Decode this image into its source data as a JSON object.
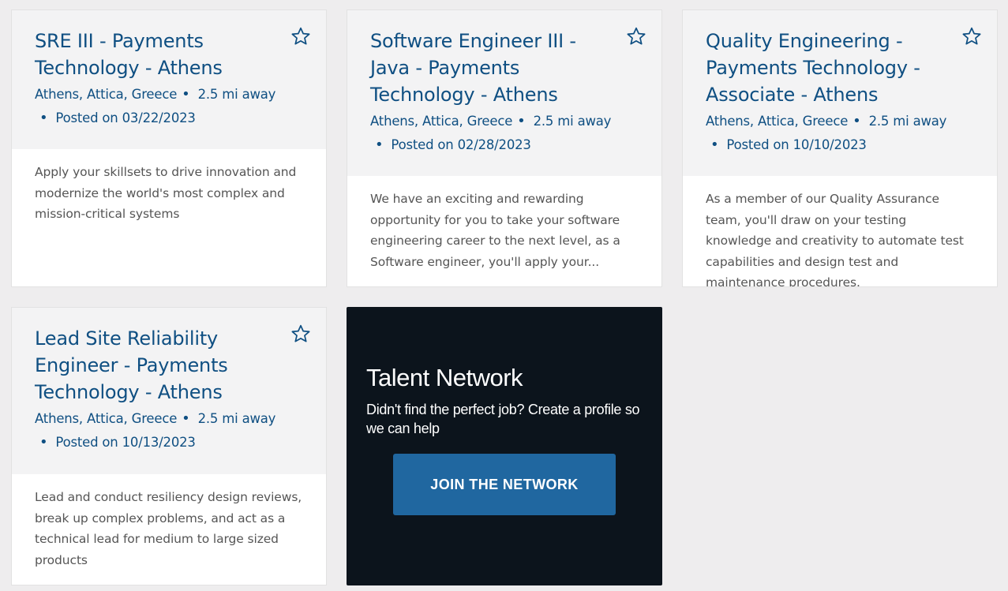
{
  "jobs": [
    {
      "title": "SRE III - Payments Technology - Athens",
      "location": "Athens, Attica, Greece",
      "distance": "2.5 mi away",
      "posted": "Posted on 03/22/2023",
      "description": "Apply your skillsets to drive innovation and modernize the world's most complex and mission-critical systems"
    },
    {
      "title": "Software Engineer III - Java - Payments Technology - Athens",
      "location": "Athens, Attica, Greece",
      "distance": "2.5 mi away",
      "posted": "Posted on 02/28/2023",
      "description": "We have an exciting and rewarding opportunity for you to take your software engineering career to the next level, as a Software engineer, you'll apply your..."
    },
    {
      "title": "Quality Engineering - Payments Technology - Associate - Athens",
      "location": "Athens, Attica, Greece",
      "distance": "2.5 mi away",
      "posted": "Posted on 10/10/2023",
      "description": "As a member of our Quality Assurance team, you'll draw on your testing knowledge and creativity to automate test capabilities and design test and maintenance procedures."
    },
    {
      "title": "Lead Site Reliability Engineer - Payments Technology - Athens",
      "location": "Athens, Attica, Greece",
      "distance": "2.5 mi away",
      "posted": "Posted on 10/13/2023",
      "description": "Lead and conduct resiliency design reviews, break up complex problems, and act as a technical lead for medium to large sized products"
    }
  ],
  "talent_network": {
    "title": "Talent Network",
    "subtitle": "Didn't find the perfect job? Create a profile so we can help",
    "button_label": "JOIN THE NETWORK"
  },
  "icons": {
    "save": "star-outline-icon"
  },
  "colors": {
    "title_blue": "#0f4f82",
    "button_blue": "#2067a0",
    "dark_panel": "#0c141c",
    "page_bg": "#eeedee"
  }
}
